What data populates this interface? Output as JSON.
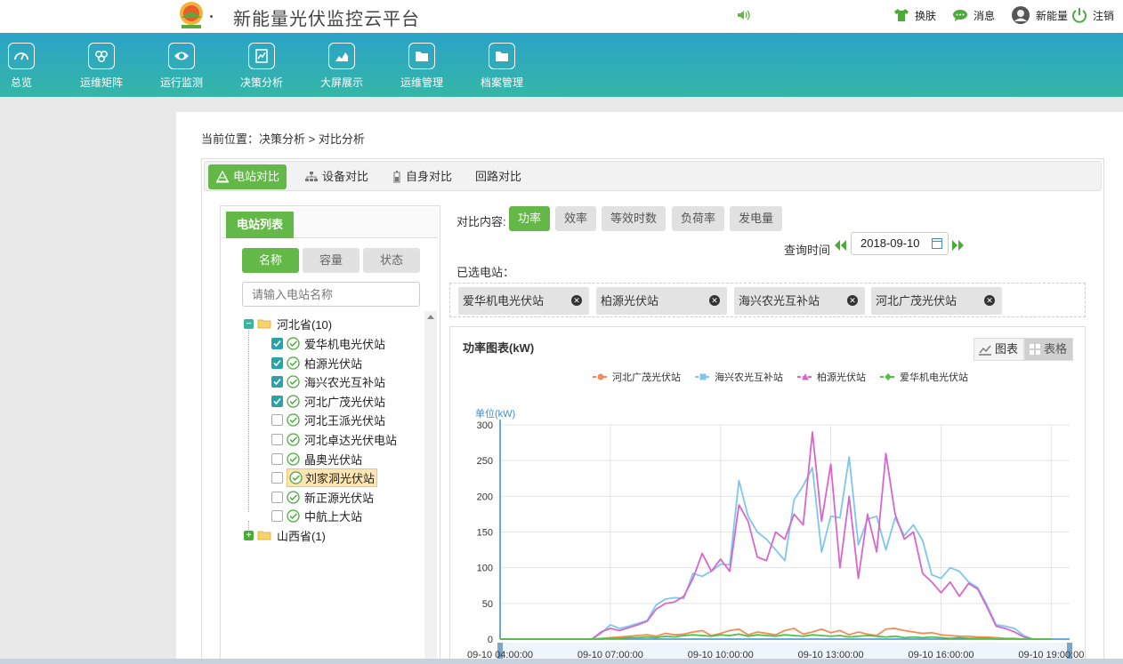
{
  "header": {
    "app_title": "新能量光伏监控云平台",
    "skin": "换肤",
    "messages": "消息",
    "user": "新能量",
    "logout": "注销"
  },
  "nav": {
    "items": [
      {
        "label": "总览",
        "icon": "gauge-icon"
      },
      {
        "label": "运维矩阵",
        "icon": "cluster-icon"
      },
      {
        "label": "运行监测",
        "icon": "eye-icon"
      },
      {
        "label": "决策分析",
        "icon": "analysis-icon"
      },
      {
        "label": "大屏展示",
        "icon": "area-chart-icon"
      },
      {
        "label": "运维管理",
        "icon": "folder-icon"
      },
      {
        "label": "档案管理",
        "icon": "folder-icon"
      }
    ]
  },
  "breadcrumb": "当前位置：决策分析 > 对比分析",
  "tabs": [
    "电站对比",
    "设备对比",
    "自身对比",
    "回路对比"
  ],
  "station_list": {
    "title": "电站列表",
    "sort_buttons": [
      "名称",
      "容量",
      "状态"
    ],
    "search_placeholder": "请输入电站名称",
    "provinces": [
      {
        "name": "河北省(10)",
        "stations": [
          {
            "name": "爱华机电光伏站",
            "checked": true
          },
          {
            "name": "柏源光伏站",
            "checked": true
          },
          {
            "name": "海兴农光互补站",
            "checked": true
          },
          {
            "name": "河北广茂光伏站",
            "checked": true
          },
          {
            "name": "河北王派光伏站",
            "checked": false
          },
          {
            "name": "河北卓达光伏电站",
            "checked": false
          },
          {
            "name": "晶奥光伏站",
            "checked": false
          },
          {
            "name": "刘家洞光伏站",
            "checked": false
          },
          {
            "name": "新正源光伏站",
            "checked": false
          },
          {
            "name": "中航上大站",
            "checked": false
          }
        ]
      },
      {
        "name": "山西省(1)",
        "stations": []
      }
    ]
  },
  "compare": {
    "label": "对比内容:",
    "options": [
      "功率",
      "效率",
      "等效时数",
      "负荷率",
      "发电量"
    ],
    "query_label": "查询时间",
    "date": "2018-09-10",
    "selected_label": "已选电站：",
    "selected": [
      "爱华机电光伏站",
      "柏源光伏站",
      "海兴农光互补站",
      "河北广茂光伏站"
    ]
  },
  "chart_header": {
    "title": "功率图表(kW)",
    "view_chart": "图表",
    "view_table": "表格"
  },
  "chart_data": {
    "type": "line",
    "ylabel": "单位(kW)",
    "ylim": [
      0,
      300
    ],
    "yticks": [
      0,
      50,
      100,
      150,
      200,
      250,
      300
    ],
    "xticks": [
      "09-10 04:00:00",
      "09-10 07:00:00",
      "09-10 10:00:00",
      "09-10 13:00:00",
      "09-10 16:00:00",
      "09-10 19:00:00"
    ],
    "x_hours": [
      4,
      4.25,
      4.5,
      4.75,
      5,
      5.25,
      5.5,
      5.75,
      6,
      6.25,
      6.5,
      6.75,
      7,
      7.25,
      7.5,
      7.75,
      8,
      8.25,
      8.5,
      8.75,
      9,
      9.25,
      9.5,
      9.75,
      10,
      10.25,
      10.5,
      10.75,
      11,
      11.25,
      11.5,
      11.75,
      12,
      12.25,
      12.5,
      12.75,
      13,
      13.25,
      13.5,
      13.75,
      14,
      14.25,
      14.5,
      14.75,
      15,
      15.25,
      15.5,
      15.75,
      16,
      16.25,
      16.5,
      16.75,
      17,
      17.25,
      17.5,
      17.75,
      18,
      18.25,
      18.5,
      18.75,
      19
    ],
    "series": [
      {
        "name": "河北广茂光伏站",
        "color": "#f28c57",
        "marker": "circle",
        "values": [
          0,
          0,
          0,
          0,
          0,
          0,
          0,
          0,
          0,
          0,
          0,
          1,
          2,
          3,
          4,
          5,
          6,
          4,
          8,
          6,
          7,
          10,
          12,
          5,
          8,
          12,
          14,
          6,
          10,
          8,
          6,
          12,
          15,
          7,
          10,
          14,
          9,
          12,
          6,
          10,
          7,
          5,
          14,
          15,
          12,
          10,
          8,
          9,
          6,
          5,
          4,
          4,
          3,
          3,
          2,
          1,
          1,
          0,
          0,
          0,
          0
        ]
      },
      {
        "name": "海兴农光互补站",
        "color": "#7fc6ee",
        "marker": "square",
        "values": [
          0,
          0,
          0,
          0,
          0,
          0,
          0,
          0,
          0,
          0,
          0,
          8,
          20,
          15,
          18,
          22,
          26,
          48,
          56,
          58,
          57,
          92,
          88,
          95,
          105,
          104,
          222,
          172,
          150,
          140,
          125,
          110,
          195,
          215,
          240,
          122,
          172,
          170,
          255,
          132,
          168,
          172,
          125,
          170,
          145,
          160,
          138,
          90,
          85,
          100,
          95,
          80,
          72,
          48,
          20,
          18,
          15,
          5,
          0,
          0,
          0
        ]
      },
      {
        "name": "柏源光伏站",
        "color": "#d867cc",
        "marker": "triangle",
        "values": [
          0,
          0,
          0,
          0,
          0,
          0,
          0,
          0,
          0,
          0,
          0,
          10,
          15,
          12,
          16,
          20,
          25,
          42,
          50,
          52,
          60,
          85,
          120,
          95,
          112,
          95,
          188,
          165,
          115,
          110,
          150,
          140,
          175,
          160,
          290,
          165,
          245,
          100,
          200,
          85,
          175,
          122,
          260,
          175,
          140,
          150,
          92,
          80,
          65,
          80,
          60,
          78,
          70,
          45,
          18,
          15,
          10,
          3,
          0,
          0,
          0
        ]
      },
      {
        "name": "爱华机电光伏站",
        "color": "#4fc143",
        "marker": "diamond",
        "values": [
          0,
          0,
          0,
          0,
          0,
          0,
          0,
          0,
          0,
          0,
          0,
          0,
          1,
          1,
          2,
          2,
          3,
          2,
          4,
          3,
          5,
          6,
          5,
          4,
          6,
          5,
          7,
          4,
          6,
          5,
          4,
          6,
          5,
          4,
          6,
          5,
          4,
          5,
          3,
          4,
          5,
          4,
          3,
          4,
          2,
          3,
          2,
          3,
          2,
          1,
          2,
          1,
          1,
          1,
          0,
          0,
          0,
          0,
          0,
          0,
          0
        ]
      }
    ]
  }
}
